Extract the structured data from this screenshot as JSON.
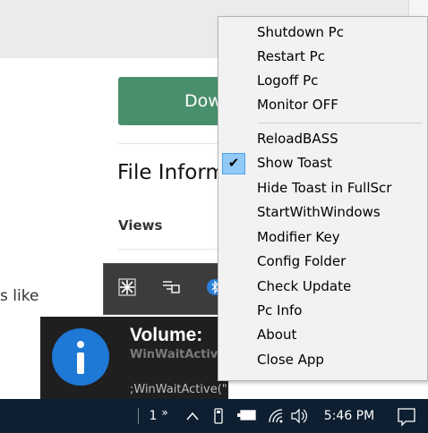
{
  "background_page": {
    "download_button": "Dow",
    "file_info_heading": "File Inform",
    "views_label": "Views",
    "side_text": "s like"
  },
  "tray_flyout": {
    "icons": [
      "snowflake-app-icon",
      "display-app-icon",
      "bluetooth-icon"
    ]
  },
  "toast": {
    "title": "Volume:",
    "subtitle": "WinWaitActive",
    "body": ";WinWaitActive(\"Notepad\", \"Do",
    "icon": "info-icon",
    "icon_color": "#1e78d6"
  },
  "context_menu": {
    "group1": [
      "Shutdown Pc",
      "Restart Pc",
      "Logoff Pc",
      "Monitor OFF"
    ],
    "group2": [
      "ReloadBASS",
      "Show Toast",
      "Hide Toast in FullScr",
      "StartWithWindows",
      "Modifier Key",
      "Config Folder",
      "Check Update",
      "Pc Info",
      "About",
      "Close App"
    ],
    "checked_item": "Show Toast",
    "check_glyph": "✔"
  },
  "taskbar": {
    "overflow_count": "1",
    "overflow_chevron": "»",
    "show_hidden": "∧",
    "time": "5:46 PM",
    "bg_color": "#0d1f31"
  }
}
